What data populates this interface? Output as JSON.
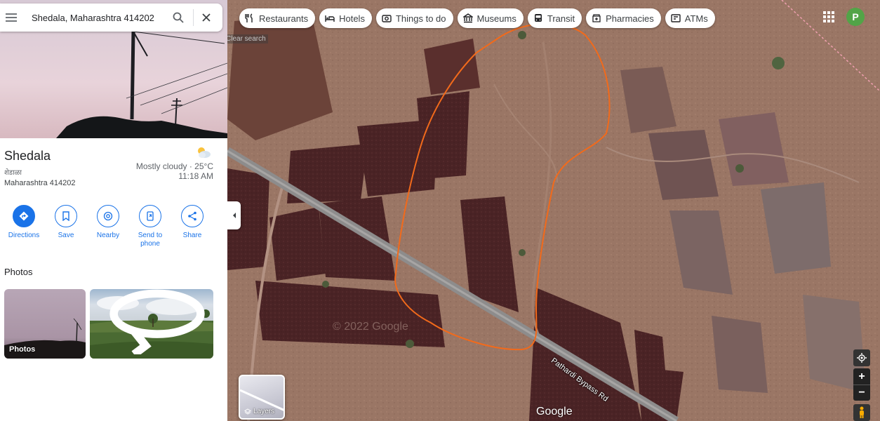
{
  "search": {
    "value": "Shedala, Maharashtra 414202",
    "clear_label": "Clear search"
  },
  "place": {
    "title": "Shedala",
    "native_name": "शेडाळा",
    "region": "Maharashtra 414202",
    "weather": {
      "condition": "Mostly cloudy · 25°C",
      "time": "11:18 AM",
      "icon": "partly-cloudy-icon"
    }
  },
  "actions": [
    {
      "label": "Directions",
      "icon": "directions-icon"
    },
    {
      "label": "Save",
      "icon": "bookmark-icon"
    },
    {
      "label": "Nearby",
      "icon": "nearby-icon"
    },
    {
      "label": "Send to phone",
      "icon": "send-to-phone-icon"
    },
    {
      "label": "Share",
      "icon": "share-icon"
    }
  ],
  "photos": {
    "heading": "Photos",
    "tile_label": "Photos"
  },
  "chips": [
    {
      "label": "Restaurants",
      "icon": "fork-knife-icon"
    },
    {
      "label": "Hotels",
      "icon": "bed-icon"
    },
    {
      "label": "Things to do",
      "icon": "camera-icon"
    },
    {
      "label": "Museums",
      "icon": "museum-icon"
    },
    {
      "label": "Transit",
      "icon": "bus-icon"
    },
    {
      "label": "Pharmacies",
      "icon": "pharmacy-icon"
    },
    {
      "label": "ATMs",
      "icon": "atm-icon"
    }
  ],
  "account": {
    "initial": "P",
    "color": "#52a447"
  },
  "map": {
    "road_label": "Pathardi Bypass Rd",
    "watermark": "© 2022 Google",
    "logo": "Google",
    "layers_label": "Layers",
    "annotation_color": "#f26a1b"
  }
}
